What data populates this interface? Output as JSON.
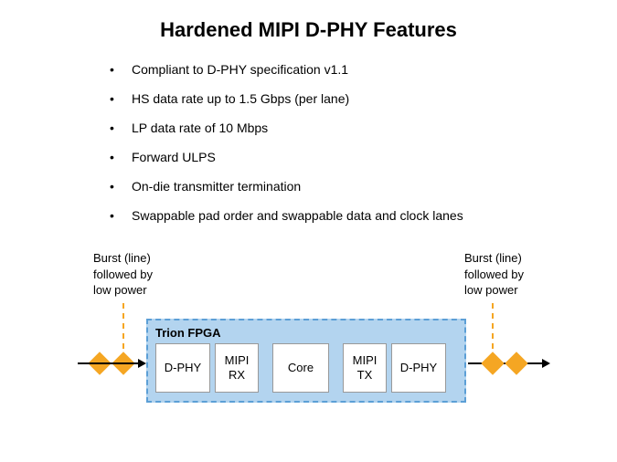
{
  "title": "Hardened MIPI D-PHY Features",
  "features": [
    "Compliant to D-PHY specification v1.1",
    "HS data rate up to 1.5 Gbps (per lane)",
    "LP data rate of 10 Mbps",
    "Forward ULPS",
    "On-die transmitter termination",
    "Swappable pad order and swappable data and clock lanes"
  ],
  "diagram": {
    "burst_left_line1": "Burst (line)",
    "burst_left_line2": "followed by",
    "burst_left_line3": "low power",
    "burst_right_line1": "Burst (line)",
    "burst_right_line2": "followed by",
    "burst_right_line3": "low power",
    "fpga_title": "Trion FPGA",
    "blocks": {
      "dphy_in": "D-PHY",
      "mipi_rx_l1": "MIPI",
      "mipi_rx_l2": "RX",
      "core": "Core",
      "mipi_tx_l1": "MIPI",
      "mipi_tx_l2": "TX",
      "dphy_out": "D-PHY"
    }
  }
}
